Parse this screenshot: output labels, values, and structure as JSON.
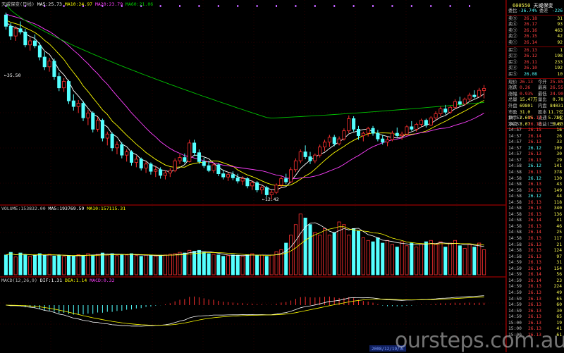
{
  "top_legend": {
    "name": "天威保变(日线)",
    "ma5": "MA5:25.73",
    "ma10": "MA10:24.97",
    "ma20": "MA20:23.79",
    "ma60": "MA60:21.06"
  },
  "price_marks": {
    "high": "35.50",
    "low": "12.42"
  },
  "volume_legend": {
    "label": "VOLUME:153832.00",
    "ma5": "MA5:193769.59",
    "ma10": "MA10:157115.31"
  },
  "macd_legend": {
    "label": "MACD(12,26,9)",
    "dif": "DIF:1.31",
    "dea": "DEA:1.14",
    "macd": "MACD:0.32"
  },
  "footer": {
    "date": "2008/12/19/五",
    "watermark": "oursteps.com.au"
  },
  "colors": {
    "up": "#ff3030",
    "down": "#54ffff",
    "ma5": "#ffffff",
    "ma10": "#ffff00",
    "ma20": "#ff40ff",
    "ma60": "#00c000",
    "grid": "#600000"
  },
  "quote": {
    "code": "600550",
    "name": "天威保变",
    "ratio_label": "委比",
    "ratio_value": "-36.74%",
    "diff_label": "委差",
    "diff_value": "-226",
    "sells": [
      {
        "label": "卖⑤",
        "price": "26.18",
        "vol": "31"
      },
      {
        "label": "卖④",
        "price": "26.17",
        "vol": "93"
      },
      {
        "label": "卖③",
        "price": "26.16",
        "vol": "463"
      },
      {
        "label": "卖②",
        "price": "26.15",
        "vol": "42"
      },
      {
        "label": "卖①",
        "price": "26.14",
        "vol": "92"
      }
    ],
    "buys": [
      {
        "label": "买①",
        "price": "26.13",
        "vol": "1"
      },
      {
        "label": "买②",
        "price": "26.12",
        "vol": "198"
      },
      {
        "label": "买③",
        "price": "26.11",
        "vol": "233"
      },
      {
        "label": "买④",
        "price": "26.10",
        "vol": "192"
      },
      {
        "label": "买⑤",
        "price": "26.08",
        "vol": "10"
      }
    ],
    "stats": [
      {
        "l1": "现价",
        "v1": "26.13",
        "l2": "今开",
        "v2": "25.85"
      },
      {
        "l1": "涨跌",
        "v1": "0.26",
        "l2": "最高",
        "v2": "26.55"
      },
      {
        "l1": "涨幅",
        "v1": "0.93%",
        "l2": "最低",
        "v2": "24.90"
      },
      {
        "l1": "总量",
        "v1": "15.47万",
        "l2": "量比",
        "v2": "0.78"
      },
      {
        "l1": "外盘",
        "v1": "69801",
        "l2": "内盘",
        "v2": "84031"
      },
      {
        "l1": "市盈",
        "v1": "31.0",
        "l2": "股本",
        "v2": "11.7亿"
      },
      {
        "l1": "换手",
        "v1": "2.69%",
        "l2": "流通",
        "v2": "5.72亿"
      },
      {
        "l1": "净资",
        "v1": "3.07",
        "l2": "收益(三)",
        "v2": "0.63"
      }
    ],
    "ticks": [
      {
        "t": "14:57",
        "p": "26.13",
        "v": "51"
      },
      {
        "t": "14:57",
        "p": "26.13",
        "v": "47"
      },
      {
        "t": "14:57",
        "p": "26.15",
        "v": "16"
      },
      {
        "t": "14:57",
        "p": "26.14",
        "v": "26"
      },
      {
        "t": "14:57",
        "p": "26.13",
        "v": "33"
      },
      {
        "t": "14:57",
        "p": "26.12",
        "v": "109"
      },
      {
        "t": "14:57",
        "p": "26.13",
        "v": "30"
      },
      {
        "t": "14:57",
        "p": "26.13",
        "v": "29"
      },
      {
        "t": "14:58",
        "p": "26.12",
        "v": "141"
      },
      {
        "t": "14:58",
        "p": "26.13",
        "v": "378"
      },
      {
        "t": "14:58",
        "p": "26.12",
        "v": "130"
      },
      {
        "t": "14:58",
        "p": "26.13",
        "v": "43"
      },
      {
        "t": "14:58",
        "p": "26.13",
        "v": "149"
      },
      {
        "t": "14:58",
        "p": "26.12",
        "v": "44"
      },
      {
        "t": "14:58",
        "p": "26.13",
        "v": "118"
      },
      {
        "t": "14:58",
        "p": "26.13",
        "v": "340"
      },
      {
        "t": "14:58",
        "p": "26.13",
        "v": "136"
      },
      {
        "t": "14:58",
        "p": "26.14",
        "v": "41"
      },
      {
        "t": "14:58",
        "p": "26.13",
        "v": "46"
      },
      {
        "t": "14:58",
        "p": "26.14",
        "v": "25"
      },
      {
        "t": "14:58",
        "p": "26.13",
        "v": "117"
      },
      {
        "t": "14:58",
        "p": "26.13",
        "v": "21"
      },
      {
        "t": "14:58",
        "p": "26.13",
        "v": "124"
      },
      {
        "t": "14:58",
        "p": "26.13",
        "v": "97"
      },
      {
        "t": "14:59",
        "p": "26.13",
        "v": "31"
      },
      {
        "t": "14:59",
        "p": "26.14",
        "v": "154"
      },
      {
        "t": "14:59",
        "p": "26.14",
        "v": "56"
      },
      {
        "t": "14:59",
        "p": "26.14",
        "v": "23"
      },
      {
        "t": "14:59",
        "p": "26.13",
        "v": "224"
      },
      {
        "t": "14:59",
        "p": "26.13",
        "v": "49"
      },
      {
        "t": "14:59",
        "p": "26.13",
        "v": "65"
      },
      {
        "t": "14:59",
        "p": "26.13",
        "v": "60"
      },
      {
        "t": "14:59",
        "p": "26.13",
        "v": "30"
      },
      {
        "t": "14:59",
        "p": "26.13",
        "v": "65"
      },
      {
        "t": "15:00",
        "p": "26.13",
        "v": "19"
      },
      {
        "t": "15:00",
        "p": "26.13",
        "v": "41"
      },
      {
        "t": "15:00",
        "p": "26.13",
        "v": "61"
      }
    ]
  },
  "chart_data": {
    "type": "candlestick",
    "price": [
      [
        35.2,
        35.5,
        33.4,
        33.8
      ],
      [
        33.8,
        34.2,
        32.1,
        32.6
      ],
      [
        32.6,
        33.8,
        32.0,
        33.5
      ],
      [
        33.5,
        34.4,
        32.8,
        33.1
      ],
      [
        33.1,
        33.5,
        31.2,
        31.5
      ],
      [
        31.5,
        32.4,
        30.8,
        32.0
      ],
      [
        32.0,
        32.8,
        31.1,
        31.4
      ],
      [
        31.4,
        31.8,
        29.6,
        30.0
      ],
      [
        30.0,
        30.6,
        28.4,
        28.8
      ],
      [
        28.8,
        29.9,
        28.2,
        29.5
      ],
      [
        29.5,
        29.8,
        27.2,
        27.6
      ],
      [
        27.6,
        28.1,
        25.8,
        26.2
      ],
      [
        26.2,
        27.4,
        25.7,
        27.0
      ],
      [
        27.0,
        27.2,
        24.2,
        24.6
      ],
      [
        24.6,
        25.4,
        23.4,
        23.9
      ],
      [
        23.9,
        24.7,
        23.1,
        24.3
      ],
      [
        24.3,
        24.6,
        22.1,
        22.5
      ],
      [
        22.5,
        23.5,
        21.6,
        23.1
      ],
      [
        23.1,
        23.3,
        20.7,
        21.1
      ],
      [
        21.1,
        22.6,
        20.8,
        22.2
      ],
      [
        22.2,
        22.4,
        19.6,
        20.0
      ],
      [
        20.0,
        20.8,
        19.1,
        20.5
      ],
      [
        20.5,
        20.7,
        18.4,
        18.8
      ],
      [
        18.8,
        19.6,
        18.0,
        19.2
      ],
      [
        19.2,
        19.5,
        17.5,
        17.9
      ],
      [
        17.9,
        18.6,
        17.1,
        18.3
      ],
      [
        18.3,
        18.5,
        16.6,
        17.0
      ],
      [
        17.0,
        17.8,
        16.4,
        17.4
      ],
      [
        17.4,
        17.6,
        16.0,
        16.3
      ],
      [
        16.3,
        17.1,
        15.7,
        16.8
      ],
      [
        16.8,
        17.0,
        15.5,
        15.9
      ],
      [
        15.9,
        16.5,
        15.2,
        16.1
      ],
      [
        16.1,
        16.4,
        15.0,
        15.4
      ],
      [
        15.4,
        16.0,
        14.9,
        15.7
      ],
      [
        15.7,
        16.3,
        15.2,
        16.0
      ],
      [
        16.0,
        17.5,
        15.8,
        17.2
      ],
      [
        17.2,
        18.0,
        16.8,
        17.6
      ],
      [
        17.6,
        18.1,
        16.9,
        17.1
      ],
      [
        17.1,
        19.8,
        17.0,
        19.4
      ],
      [
        19.4,
        19.8,
        17.8,
        18.2
      ],
      [
        18.2,
        18.6,
        16.8,
        17.1
      ],
      [
        17.1,
        17.6,
        16.3,
        16.6
      ],
      [
        16.6,
        17.2,
        15.8,
        16.0
      ],
      [
        16.0,
        16.9,
        15.7,
        16.7
      ],
      [
        16.7,
        16.9,
        15.3,
        15.6
      ],
      [
        15.6,
        16.1,
        14.9,
        15.2
      ],
      [
        15.2,
        15.8,
        14.7,
        15.5
      ],
      [
        15.5,
        15.9,
        14.8,
        15.1
      ],
      [
        15.1,
        15.6,
        14.4,
        14.7
      ],
      [
        14.7,
        15.3,
        14.2,
        15.0
      ],
      [
        15.0,
        15.2,
        13.8,
        14.1
      ],
      [
        14.1,
        14.8,
        13.6,
        14.5
      ],
      [
        14.5,
        14.7,
        13.3,
        13.6
      ],
      [
        13.6,
        14.2,
        13.1,
        13.9
      ],
      [
        13.9,
        14.1,
        12.7,
        13.0
      ],
      [
        13.0,
        13.6,
        12.42,
        13.3
      ],
      [
        13.3,
        14.4,
        13.1,
        14.2
      ],
      [
        14.2,
        15.3,
        13.9,
        15.0
      ],
      [
        15.0,
        15.6,
        14.3,
        14.6
      ],
      [
        14.6,
        16.4,
        14.5,
        16.1
      ],
      [
        16.1,
        17.5,
        15.8,
        17.2
      ],
      [
        17.2,
        18.6,
        16.9,
        18.3
      ],
      [
        18.3,
        19.1,
        17.4,
        17.7
      ],
      [
        17.7,
        18.3,
        16.8,
        17.2
      ],
      [
        17.2,
        18.1,
        16.9,
        17.9
      ],
      [
        17.9,
        19.2,
        17.6,
        18.9
      ],
      [
        18.9,
        19.8,
        18.4,
        19.5
      ],
      [
        19.5,
        20.4,
        18.9,
        20.1
      ],
      [
        20.1,
        20.4,
        19.0,
        19.3
      ],
      [
        19.3,
        20.2,
        19.1,
        19.9
      ],
      [
        19.9,
        21.2,
        19.7,
        20.9
      ],
      [
        20.9,
        22.8,
        20.6,
        22.4
      ],
      [
        22.4,
        22.7,
        20.8,
        21.1
      ],
      [
        21.1,
        21.5,
        19.8,
        20.3
      ],
      [
        20.3,
        20.8,
        19.6,
        20.6
      ],
      [
        20.6,
        21.4,
        20.2,
        21.2
      ],
      [
        21.2,
        21.5,
        20.3,
        20.6
      ],
      [
        20.6,
        21.0,
        19.6,
        19.9
      ],
      [
        19.9,
        20.4,
        19.2,
        19.5
      ],
      [
        19.5,
        20.2,
        19.0,
        19.8
      ],
      [
        19.8,
        20.9,
        19.6,
        20.6
      ],
      [
        20.6,
        21.3,
        20.1,
        20.3
      ],
      [
        20.3,
        20.8,
        19.8,
        20.5
      ],
      [
        20.5,
        21.6,
        20.3,
        21.4
      ],
      [
        21.4,
        22.1,
        20.9,
        21.1
      ],
      [
        21.1,
        21.9,
        20.8,
        21.7
      ],
      [
        21.7,
        22.4,
        21.4,
        22.2
      ],
      [
        22.2,
        22.4,
        21.3,
        21.6
      ],
      [
        21.6,
        22.7,
        21.5,
        22.5
      ],
      [
        22.5,
        23.3,
        22.2,
        23.0
      ],
      [
        23.0,
        23.9,
        22.7,
        23.6
      ],
      [
        23.6,
        24.1,
        22.9,
        23.2
      ],
      [
        23.2,
        24.0,
        23.0,
        23.8
      ],
      [
        23.8,
        24.8,
        23.6,
        24.5
      ],
      [
        24.5,
        25.1,
        23.9,
        24.2
      ],
      [
        24.2,
        25.0,
        24.0,
        24.8
      ],
      [
        24.8,
        25.6,
        24.5,
        25.3
      ],
      [
        25.3,
        25.9,
        24.9,
        25.1
      ],
      [
        25.1,
        26.2,
        25.0,
        25.9
      ],
      [
        25.87,
        26.55,
        24.9,
        26.13
      ]
    ],
    "volume": [
      150,
      170,
      135,
      165,
      150,
      140,
      145,
      160,
      148,
      155,
      142,
      150,
      138,
      146,
      140,
      152,
      145,
      160,
      150,
      155,
      165,
      150,
      160,
      145,
      155,
      150,
      160,
      145,
      140,
      148,
      150,
      142,
      148,
      150,
      155,
      160,
      170,
      165,
      185,
      178,
      185,
      170,
      160,
      155,
      150,
      140,
      145,
      150,
      148,
      142,
      152,
      160,
      145,
      150,
      140,
      150,
      175,
      190,
      240,
      300,
      380,
      460,
      430,
      380,
      320,
      300,
      350,
      300,
      320,
      400,
      380,
      300,
      350,
      330,
      280,
      260,
      250,
      280,
      240,
      260,
      230,
      210,
      250,
      220,
      240,
      210,
      230,
      250,
      260,
      230,
      250,
      210,
      240,
      260,
      220,
      200,
      230,
      210,
      240,
      190
    ],
    "vol_ylim": [
      0,
      480
    ],
    "ylim": [
      12,
      36
    ]
  }
}
